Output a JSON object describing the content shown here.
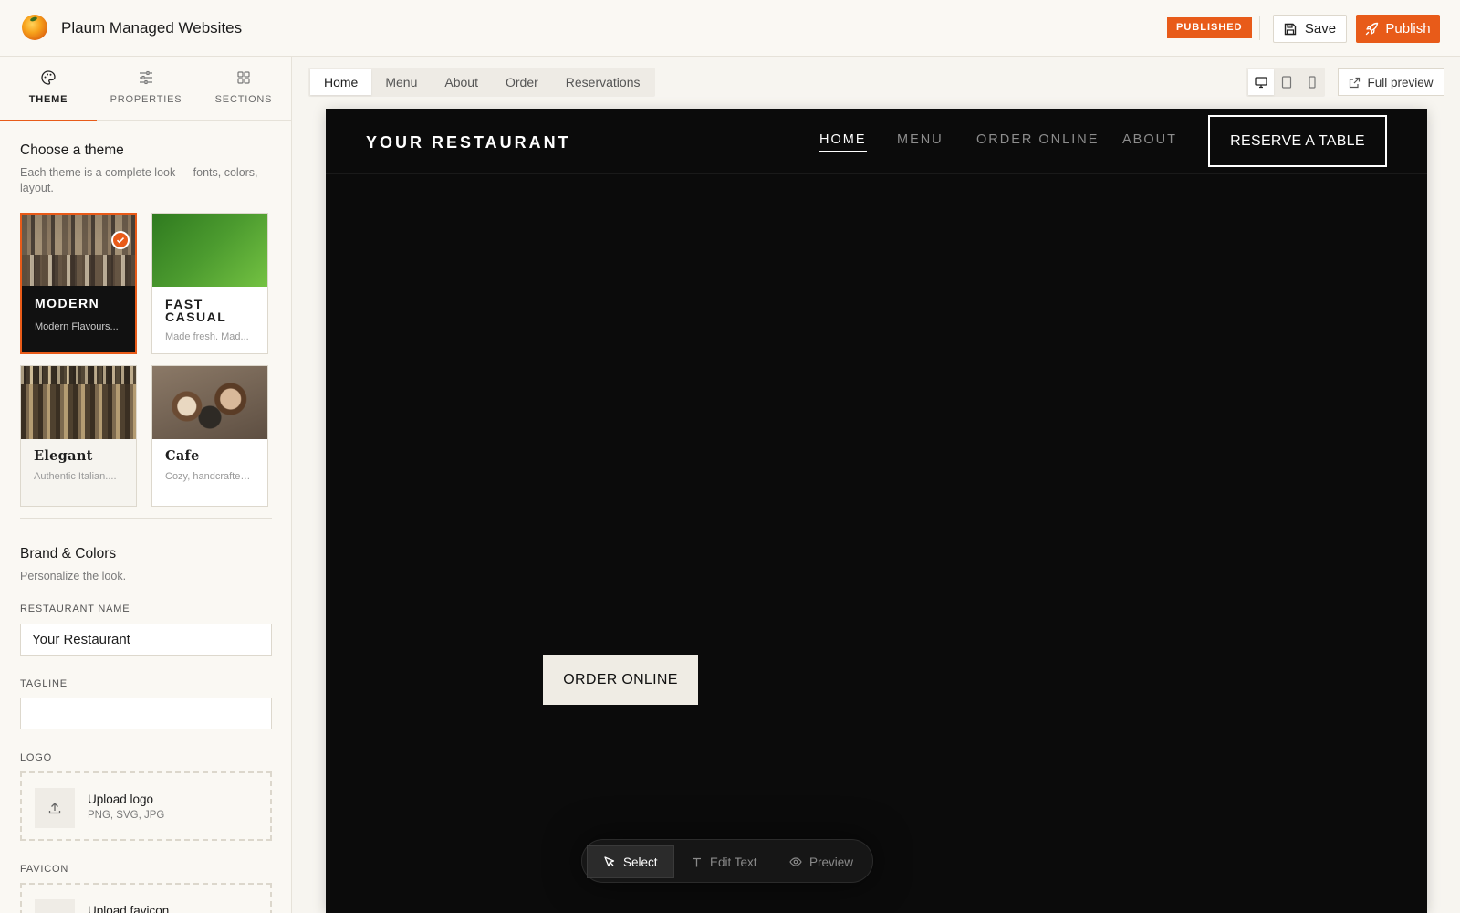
{
  "app": {
    "title": "Plaum Managed Websites"
  },
  "header": {
    "status_badge": "PUBLISHED",
    "save_label": "Save",
    "publish_label": "Publish"
  },
  "sidebar": {
    "tabs": [
      {
        "label": "THEME",
        "icon": "palette-icon",
        "active": true
      },
      {
        "label": "PROPERTIES",
        "icon": "sliders-icon",
        "active": false
      },
      {
        "label": "SECTIONS",
        "icon": "grid-icon",
        "active": false
      }
    ],
    "theme_section": {
      "title": "Choose a theme",
      "description": "Each theme is a complete look — fonts, colors, layout.",
      "themes": [
        {
          "name": "MODERN",
          "subtitle": "Modern Flavours...",
          "selected": true
        },
        {
          "name": "FAST CASUAL",
          "subtitle": "Made fresh. Mad...",
          "selected": false
        },
        {
          "name": "Elegant",
          "subtitle": "Authentic Italian....",
          "selected": false
        },
        {
          "name": "Cafe",
          "subtitle": "Cozy, handcrafted,...",
          "selected": false
        }
      ]
    },
    "brand_section": {
      "title": "Brand & Colors",
      "description": "Personalize the look.",
      "restaurant_name_label": "RESTAURANT NAME",
      "restaurant_name_value": "Your Restaurant",
      "tagline_label": "TAGLINE",
      "tagline_value": "",
      "logo_label": "LOGO",
      "logo_upload_title": "Upload logo",
      "logo_upload_formats": "PNG, SVG, JPG",
      "favicon_label": "FAVICON",
      "favicon_upload_title": "Upload favicon"
    }
  },
  "page_tabs": [
    "Home",
    "Menu",
    "About",
    "Order",
    "Reservations"
  ],
  "active_page": "Home",
  "preview_controls": {
    "full_preview_label": "Full preview",
    "active_device": "desktop"
  },
  "site": {
    "brand": "YOUR RESTAURANT",
    "nav": [
      "HOME",
      "MENU",
      "ORDER ONLINE",
      "ABOUT"
    ],
    "reserve_label": "RESERVE A TABLE",
    "order_label": "ORDER ONLINE"
  },
  "editor_toolbar": [
    {
      "label": "Select",
      "icon": "cursor-icon",
      "active": true
    },
    {
      "label": "Edit Text",
      "icon": "text-icon",
      "active": false
    },
    {
      "label": "Preview",
      "icon": "eye-icon",
      "active": false
    }
  ],
  "colors": {
    "accent": "#e85b19",
    "canvas_bg": "#0b0b0b",
    "sidebar_bg": "#faf8f3"
  }
}
